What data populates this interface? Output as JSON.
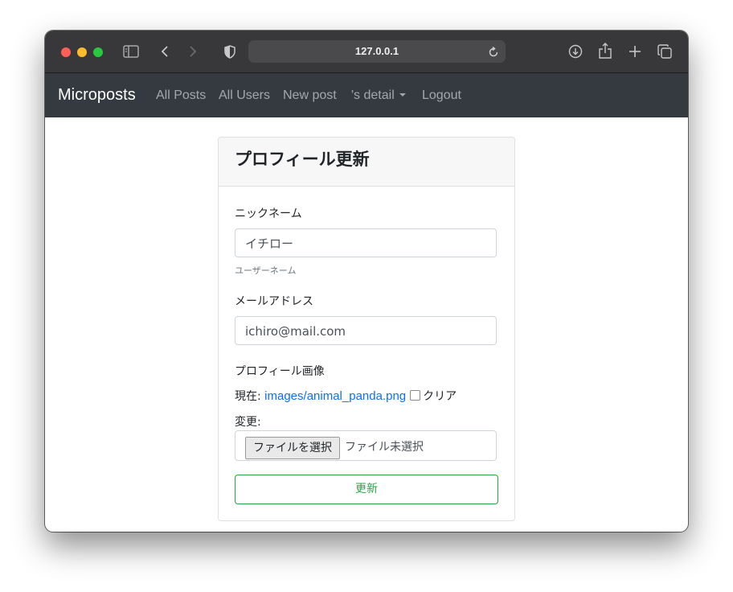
{
  "browser": {
    "url": "127.0.0.1",
    "icons": [
      "sidebar-icon",
      "back-icon",
      "forward-icon",
      "shield-icon",
      "reload-icon",
      "download-icon",
      "share-icon",
      "new-tab-icon",
      "tabs-overview-icon"
    ]
  },
  "navbar": {
    "brand": "Microposts",
    "links": [
      "All Posts",
      "All Users",
      "New post",
      "'s detail",
      "Logout"
    ]
  },
  "form": {
    "title": "プロフィール更新",
    "nickname_label": "ニックネーム",
    "nickname_value": "イチロー",
    "nickname_help": "ユーザーネーム",
    "email_label": "メールアドレス",
    "email_value": "ichiro@mail.com",
    "image_label": "プロフィール画像",
    "current_label": "現在:",
    "current_file": "images/animal_panda.png",
    "clear_label": "クリア",
    "change_label": "変更:",
    "file_button": "ファイルを選択",
    "file_status": "ファイル未選択",
    "submit_label": "更新"
  },
  "colors": {
    "navbar_bg": "#343a40",
    "link": "#0d6efd",
    "submit_outline": "#28a745"
  }
}
